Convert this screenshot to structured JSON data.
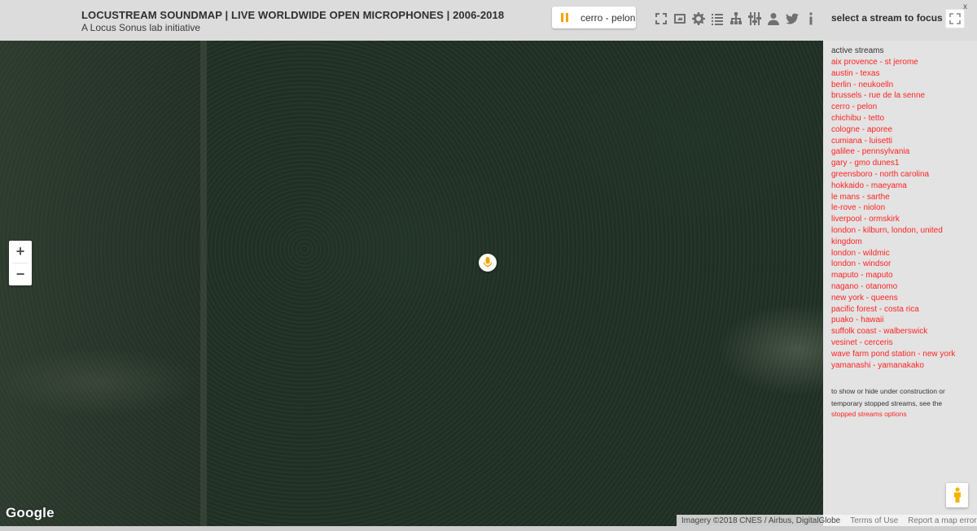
{
  "header": {
    "title": "LOCUSTREAM SOUNDMAP | LIVE WORLDWIDE OPEN MICROPHONES | 2006-2018",
    "subtitle": "A Locus Sonus lab initiative",
    "now_playing": "cerro - pelon",
    "focus_label": "select a stream to focus on",
    "close": "x",
    "toolbar_icons": [
      "fullscreen-icon",
      "tour-icon",
      "gear-icon",
      "list-icon",
      "sitemap-icon",
      "mixer-icon",
      "user-icon",
      "twitter-icon",
      "info-icon"
    ]
  },
  "map": {
    "zoom_in": "+",
    "zoom_out": "−",
    "logo": "Google",
    "attribution": {
      "imagery": "Imagery ©2018 CNES / Airbus, DigitalGlobe",
      "terms": "Terms of Use",
      "report": "Report a map error"
    }
  },
  "sidebar": {
    "heading": "active streams",
    "streams": [
      "aix provence - st jerome",
      "austin - texas",
      "berlin - neukoelln",
      "brussels - rue de la senne",
      "cerro - pelon",
      "chichibu - tetto",
      "cologne - aporee",
      "cumiana - luisetti",
      "galilee - pennsylvania",
      "gary - gmo dunes1",
      "greensboro - north carolina",
      "hokkaido - maeyama",
      "le mans - sarthe",
      "le-rove - niolon",
      "liverpool - ormskirk",
      "london - kilburn, london, united kingdom",
      "london - wildmic",
      "london - windsor",
      "maputo - maputo",
      "nagano - otanomo",
      "new york - queens",
      "pacific forest - costa rica",
      "puako - hawaii",
      "suffolk coast - walberswick",
      "vesinet - cerceris",
      "wave farm pond station - new york",
      "yamanashi - yamanakako"
    ],
    "stopped_note": "to show or hide under construction or temporary stopped streams, see the",
    "stopped_link": "stopped streams options"
  },
  "colors": {
    "accent_pause": "#f5a300",
    "stream_link": "#ff2222"
  }
}
